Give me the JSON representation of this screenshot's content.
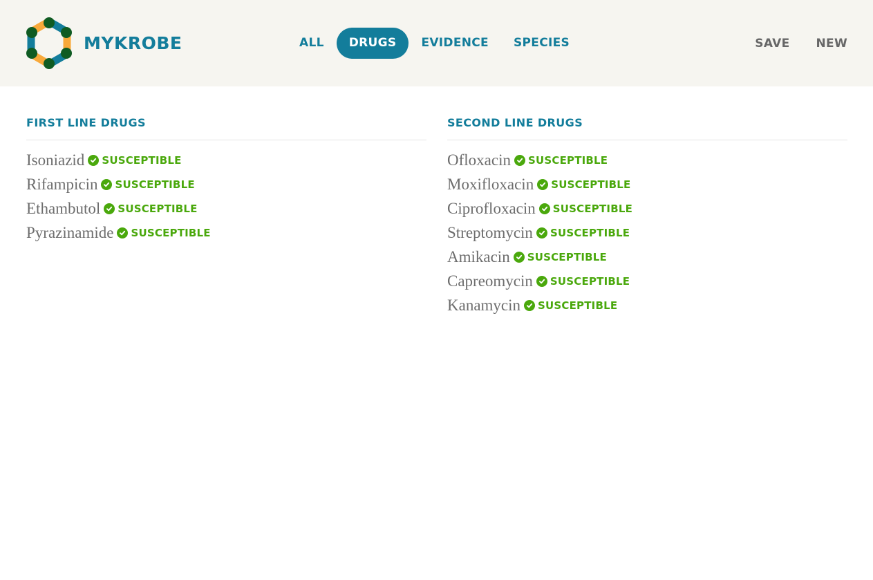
{
  "colors": {
    "brand": "#137d9b",
    "susceptible": "#4aa80c",
    "header_bg": "#f6f5f0",
    "muted_text": "#676767"
  },
  "header": {
    "brand_name": "MYKROBE",
    "logo_icon": "hexagon-logo-icon"
  },
  "nav": {
    "tabs": [
      {
        "label": "ALL",
        "active": false
      },
      {
        "label": "DRUGS",
        "active": true
      },
      {
        "label": "EVIDENCE",
        "active": false
      },
      {
        "label": "SPECIES",
        "active": false
      }
    ]
  },
  "actions": {
    "save_label": "SAVE",
    "new_label": "NEW"
  },
  "first_line": {
    "title": "FIRST LINE DRUGS",
    "drugs": [
      {
        "name": "Isoniazid",
        "status": "SUSCEPTIBLE",
        "icon": "check-circle-icon"
      },
      {
        "name": "Rifampicin",
        "status": "SUSCEPTIBLE",
        "icon": "check-circle-icon"
      },
      {
        "name": "Ethambutol",
        "status": "SUSCEPTIBLE",
        "icon": "check-circle-icon"
      },
      {
        "name": "Pyrazinamide",
        "status": "SUSCEPTIBLE",
        "icon": "check-circle-icon"
      }
    ]
  },
  "second_line": {
    "title": "SECOND LINE DRUGS",
    "drugs": [
      {
        "name": "Ofloxacin",
        "status": "SUSCEPTIBLE",
        "icon": "check-circle-icon"
      },
      {
        "name": "Moxifloxacin",
        "status": "SUSCEPTIBLE",
        "icon": "check-circle-icon"
      },
      {
        "name": "Ciprofloxacin",
        "status": "SUSCEPTIBLE",
        "icon": "check-circle-icon"
      },
      {
        "name": "Streptomycin",
        "status": "SUSCEPTIBLE",
        "icon": "check-circle-icon"
      },
      {
        "name": "Amikacin",
        "status": "SUSCEPTIBLE",
        "icon": "check-circle-icon"
      },
      {
        "name": "Capreomycin",
        "status": "SUSCEPTIBLE",
        "icon": "check-circle-icon"
      },
      {
        "name": "Kanamycin",
        "status": "SUSCEPTIBLE",
        "icon": "check-circle-icon"
      }
    ]
  }
}
